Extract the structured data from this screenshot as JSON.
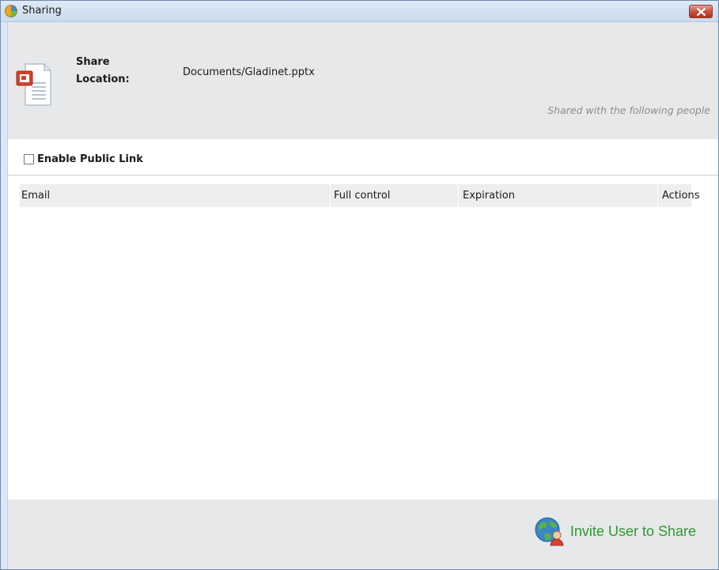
{
  "window": {
    "title": "Sharing"
  },
  "header": {
    "share_label_line1": "Share",
    "share_label_line2": "Location:",
    "share_path": "Documents/Gladinet.pptx",
    "shared_with_text": "Shared with the following people",
    "file_icon": "powerpoint-file-icon"
  },
  "public_link": {
    "label": "Enable Public Link",
    "checked": false
  },
  "table": {
    "columns": [
      "Email",
      "Full control",
      "Expiration",
      "Actions"
    ],
    "rows": []
  },
  "footer": {
    "invite_label": "Invite User to Share",
    "invite_icon": "invite-user-globe-icon"
  },
  "colors": {
    "accent_green": "#2e9a2e",
    "close_red": "#c8513f"
  }
}
